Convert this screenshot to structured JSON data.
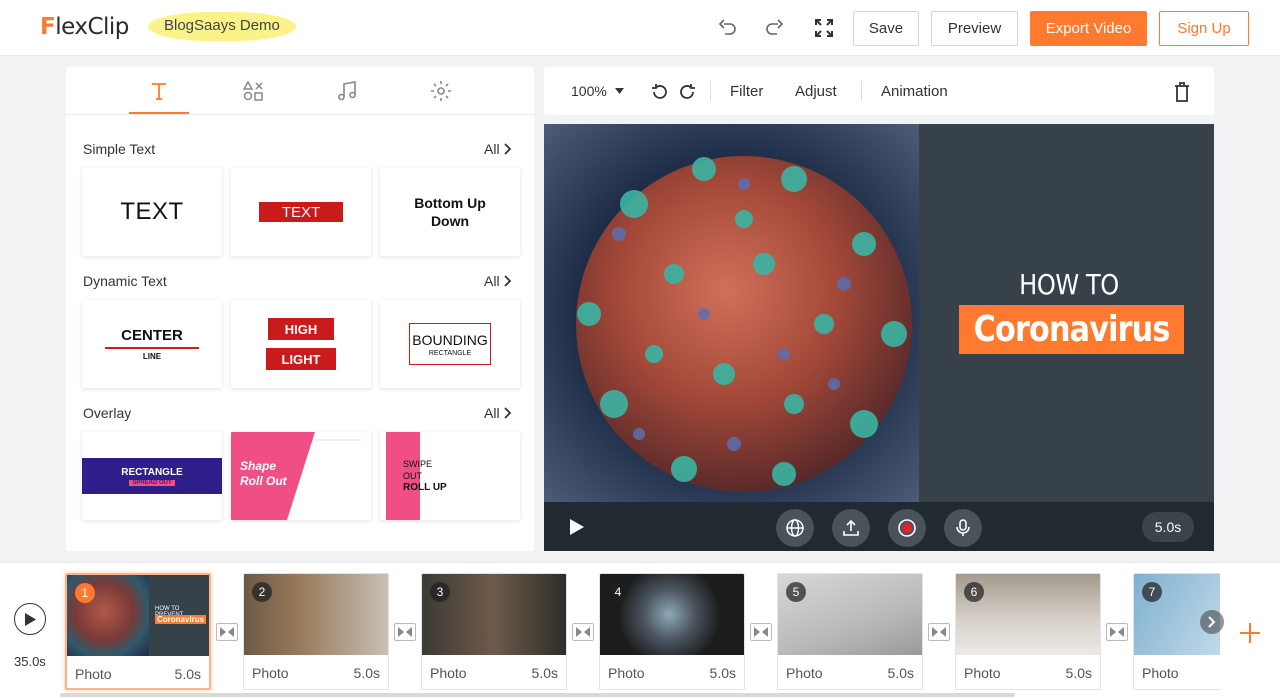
{
  "header": {
    "logo_f": "F",
    "logo_rest": "lexClip",
    "project_name": "BlogSaays Demo",
    "save_label": "Save",
    "preview_label": "Preview",
    "export_label": "Export Video",
    "signup_label": "Sign Up",
    "icons": [
      "undo-icon",
      "redo-icon",
      "fullscreen-icon"
    ]
  },
  "tabs": [
    "text-icon",
    "elements-icon",
    "music-icon",
    "settings-icon"
  ],
  "sections": {
    "simple": {
      "title": "Simple Text",
      "all": "All"
    },
    "dynamic": {
      "title": "Dynamic Text",
      "all": "All"
    },
    "overlay": {
      "title": "Overlay",
      "all": "All"
    }
  },
  "cards": {
    "simple1": "TEXT",
    "simple2": "TEXT",
    "simple3_a": "Bottom Up",
    "simple3_b": "Down",
    "dyn1_a": "CENTER",
    "dyn1_b": "LINE",
    "dyn2_a": "HIGH",
    "dyn2_b": "LIGHT",
    "dyn3_a": "BOUNDING",
    "dyn3_b": "RECTANGLE",
    "ov1_a": "RECTANGLE",
    "ov1_b": "SPREAD OUT",
    "ov2_a": "Shape",
    "ov2_b": "Roll Out",
    "ov3_a": "SWIPE",
    "ov3_b": "OUT",
    "ov3_c": "ROLL UP"
  },
  "editor": {
    "zoom": "100%",
    "filter": "Filter",
    "adjust": "Adjust",
    "animation": "Animation"
  },
  "canvas": {
    "caption_top": "HOW TO PREVENT",
    "caption_main": "Coronavirus"
  },
  "playbar": {
    "duration": "5.0s"
  },
  "timeline": {
    "total": "35.0s",
    "clips": [
      {
        "num": "1",
        "type": "Photo",
        "dur": "5.0s"
      },
      {
        "num": "2",
        "type": "Photo",
        "dur": "5.0s"
      },
      {
        "num": "3",
        "type": "Photo",
        "dur": "5.0s"
      },
      {
        "num": "4",
        "type": "Photo",
        "dur": "5.0s"
      },
      {
        "num": "5",
        "type": "Photo",
        "dur": "5.0s"
      },
      {
        "num": "6",
        "type": "Photo",
        "dur": "5.0s"
      },
      {
        "num": "7",
        "type": "Photo",
        "dur": ""
      }
    ],
    "thumb1_top": "HOW TO PREVENT",
    "thumb1_main": "Coronavirus"
  },
  "colors": {
    "accent": "#ff7a2e",
    "canvas_bg": "#37414a",
    "highlight": "#fbf38a"
  }
}
